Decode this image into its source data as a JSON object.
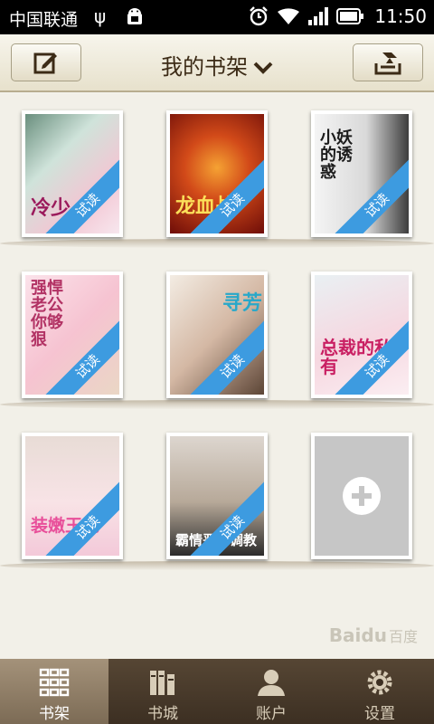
{
  "status_bar": {
    "carrier": "中国联通",
    "usb_icon": "usb-icon",
    "time": "11:50"
  },
  "header": {
    "title": "我的书架",
    "left_button_icon": "edit-icon",
    "right_button_icon": "import-icon"
  },
  "books": [
    {
      "cover_title": "冷少",
      "badge": "试读",
      "colors": [
        "#f3c6d3",
        "#6a8f7e"
      ]
    },
    {
      "cover_title": "龙血战",
      "badge": "试读",
      "colors": [
        "#b31c10",
        "#f5a233"
      ]
    },
    {
      "cover_title": "小妖的诱惑",
      "badge": "试读",
      "colors": [
        "#e6e6e6",
        "#4a4a4a"
      ]
    },
    {
      "cover_title": "强悍老公你够狠",
      "badge": "试读",
      "colors": [
        "#fbe2ea",
        "#d8557a"
      ]
    },
    {
      "cover_title": "寻芳",
      "badge": "试读",
      "colors": [
        "#f3ece3",
        "#3fb7d0"
      ]
    },
    {
      "cover_title": "总裁的私有",
      "badge": "试读",
      "colors": [
        "#fbe6ed",
        "#c92063"
      ]
    },
    {
      "cover_title": "装嫩王妃",
      "badge": "试读",
      "colors": [
        "#f8e3e6",
        "#e84f9a"
      ]
    },
    {
      "cover_title": "霸情恶少调教",
      "badge": "试读",
      "colors": [
        "#ddd6cf",
        "#2b2b2b"
      ]
    }
  ],
  "add_book_icon": "plus-icon",
  "watermark": {
    "latin": "Bai",
    "paw": "du",
    "cn": "百度"
  },
  "bottom_nav": [
    {
      "label": "书架",
      "icon": "grid-icon",
      "active": true
    },
    {
      "label": "书城",
      "icon": "books-icon",
      "active": false
    },
    {
      "label": "账户",
      "icon": "user-icon",
      "active": false
    },
    {
      "label": "设置",
      "icon": "gear-icon",
      "active": false
    }
  ]
}
